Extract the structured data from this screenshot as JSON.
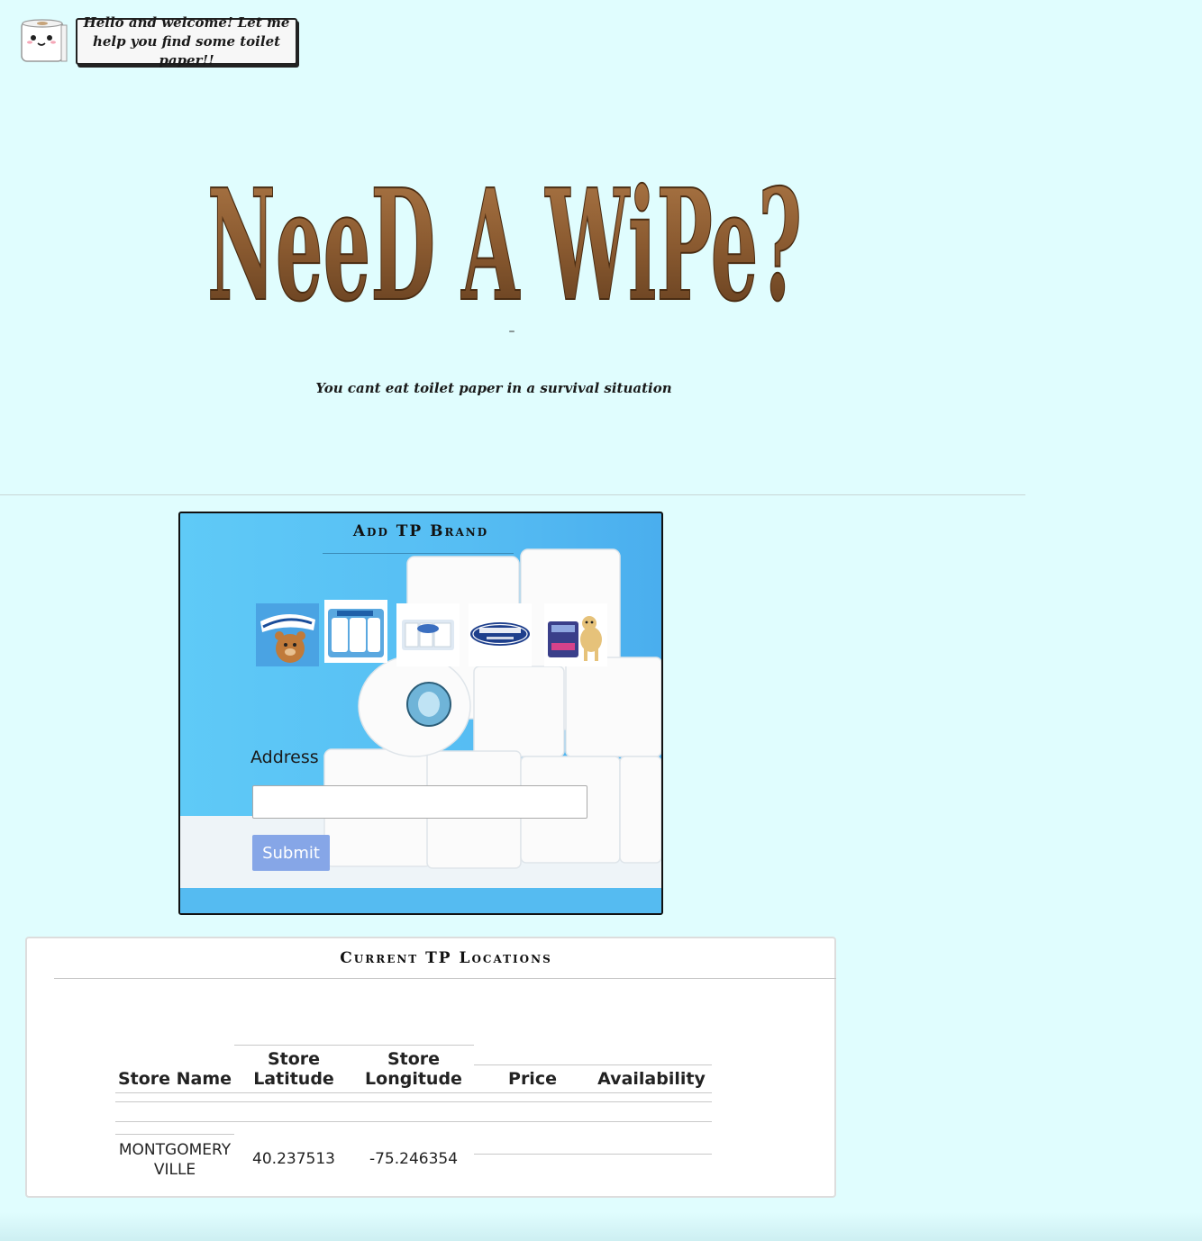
{
  "mascot": {
    "icon": "toilet-paper-mascot-icon"
  },
  "greeting": {
    "text": "Hello and welcome! Let me help you find some toilet paper!!"
  },
  "hero": {
    "title": "NeeD A WiPe?",
    "dash": "–",
    "tagline": "You cant eat toilet paper in a survival situation"
  },
  "brand_form": {
    "title": "Add TP Brand",
    "brands": [
      {
        "name": "Charmin"
      },
      {
        "name": "Angel Soft"
      },
      {
        "name": "Scott"
      },
      {
        "name": "Quilted Northern"
      },
      {
        "name": "Cottonelle"
      }
    ],
    "address_label": "Address",
    "address_value": "",
    "submit_label": "Submit"
  },
  "locations": {
    "title": "Current TP Locations",
    "columns": [
      "Store Name",
      "Store Latitude",
      "Store Longitude",
      "Price",
      "Availability"
    ],
    "rows": [
      {
        "store_name": "MONTGOMERYVILLE",
        "latitude": "40.237513",
        "longitude": "-75.246354",
        "price": "",
        "availability": ""
      }
    ]
  },
  "colors": {
    "background": "#e0fdfe",
    "panel_blue": "#56bdf3",
    "submit": "#86a6e7",
    "title_brown": "#8a5a30"
  }
}
